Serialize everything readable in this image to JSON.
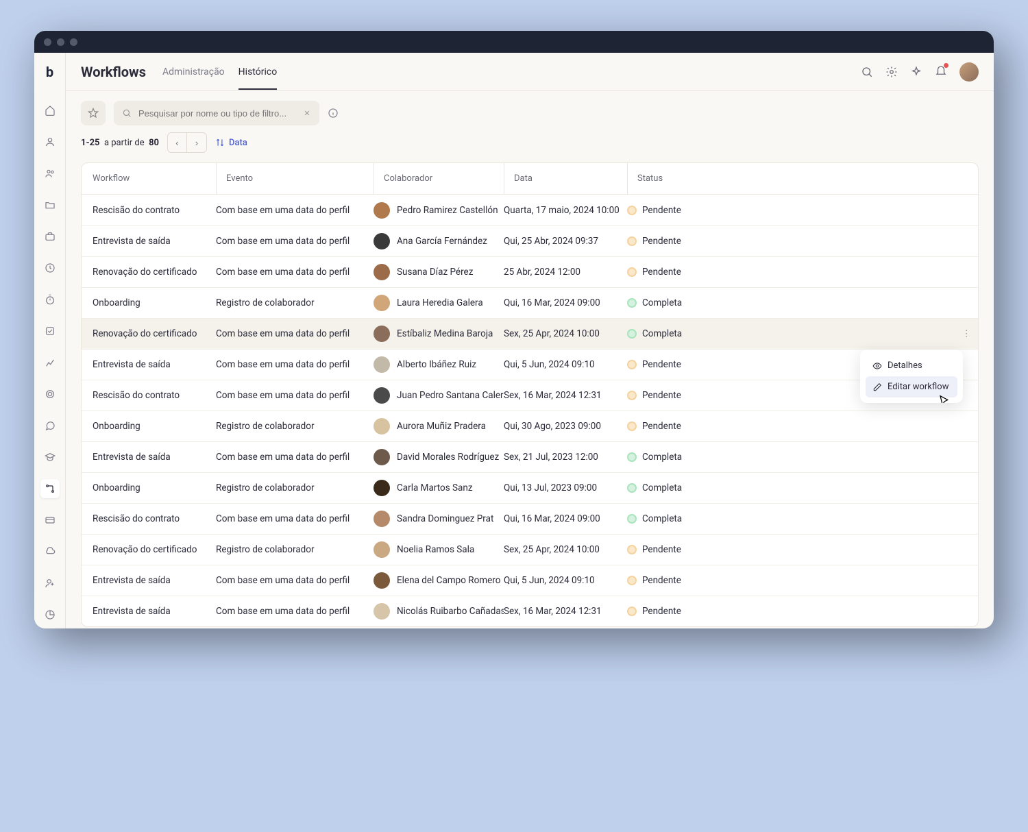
{
  "header": {
    "title": "Workflows",
    "tabs": [
      "Administração",
      "Histórico"
    ],
    "activeTab": 1
  },
  "search": {
    "placeholder": "Pesquisar por nome ou tipo de filtro..."
  },
  "pagination": {
    "range": "1-25",
    "middle": "a partir de",
    "total": "80",
    "sortLabel": "Data"
  },
  "columns": [
    "Workflow",
    "Evento",
    "Colaborador",
    "Data",
    "Status"
  ],
  "statusLabels": {
    "pending": "Pendente",
    "complete": "Completa"
  },
  "popover": {
    "details": "Detalhes",
    "edit": "Editar workflow"
  },
  "rows": [
    {
      "workflow": "Rescisão do contrato",
      "event": "Com base em uma data do perfil",
      "name": "Pedro Ramirez Castellón",
      "date": "Quarta, 17 maio, 2024 10:00",
      "status": "pending",
      "avColor": "#b07a4d"
    },
    {
      "workflow": "Entrevista de saída",
      "event": "Com base em uma data do perfil",
      "name": "Ana García Fernández",
      "date": "Qui, 25 Abr, 2024 09:37",
      "status": "pending",
      "avColor": "#3a3a3a"
    },
    {
      "workflow": "Renovação do certificado",
      "event": "Com base em uma data do perfil",
      "name": "Susana Díaz Pérez",
      "date": "25 Abr, 2024 12:00",
      "status": "pending",
      "avColor": "#9b6b4a"
    },
    {
      "workflow": "Onboarding",
      "event": "Registro de colaborador",
      "name": "Laura Heredia Galera",
      "date": "Qui, 16 Mar, 2024 09:00",
      "status": "complete",
      "avColor": "#d1a77a"
    },
    {
      "workflow": "Renovação do certificado",
      "event": "Com base em uma data do perfil",
      "name": "Estíbaliz Medina Baroja",
      "date": "Sex, 25 Apr, 2024 10:00",
      "status": "complete",
      "avColor": "#8a6d5a",
      "highlight": true,
      "menu": true
    },
    {
      "workflow": "Entrevista de saída",
      "event": "Com base em uma data do perfil",
      "name": "Alberto Ibáñez Ruiz",
      "date": "Qui, 5 Jun, 2024 09:10",
      "status": "pending",
      "avColor": "#c2b9a8",
      "popover": true
    },
    {
      "workflow": "Rescisão do contrato",
      "event": "Com base em uma data do perfil",
      "name": "Juan Pedro Santana Calero",
      "date": "Sex, 16 Mar, 2024 12:31",
      "status": "pending",
      "avColor": "#4a4a4a"
    },
    {
      "workflow": "Onboarding",
      "event": "Registro de colaborador",
      "name": "Aurora Muñiz Pradera",
      "date": "Qui, 30 Ago, 2023 09:00",
      "status": "pending",
      "avColor": "#d8c3a0"
    },
    {
      "workflow": "Entrevista de saída",
      "event": "Com base em uma data do perfil",
      "name": "David Morales Rodríguez",
      "date": "Sex, 21 Jul, 2023 12:00",
      "status": "complete",
      "avColor": "#6d5a4a"
    },
    {
      "workflow": "Onboarding",
      "event": "Registro de colaborador",
      "name": "Carla Martos Sanz",
      "date": "Qui, 13 Jul, 2023 09:00",
      "status": "complete",
      "avColor": "#3a2a1a"
    },
    {
      "workflow": "Rescisão do contrato",
      "event": "Com base em uma data do perfil",
      "name": "Sandra Dominguez Prat",
      "date": "Qui, 16 Mar, 2024 09:00",
      "status": "complete",
      "avColor": "#b58a6a"
    },
    {
      "workflow": "Renovação do certificado",
      "event": "Registro de colaborador",
      "name": "Noelia Ramos Sala",
      "date": "Sex, 25 Apr, 2024 10:00",
      "status": "pending",
      "avColor": "#c9a882"
    },
    {
      "workflow": "Entrevista de saída",
      "event": "Com base em uma data do perfil",
      "name": "Elena del Campo Romero",
      "date": "Qui, 5 Jun, 2024 09:10",
      "status": "pending",
      "avColor": "#7a5a3a"
    },
    {
      "workflow": "Entrevista de saída",
      "event": "Com base em uma data do perfil",
      "name": "Nicolás Ruibarbo Cañadas",
      "date": "Sex, 16 Mar, 2024 12:31",
      "status": "pending",
      "avColor": "#d6c5a8"
    }
  ]
}
